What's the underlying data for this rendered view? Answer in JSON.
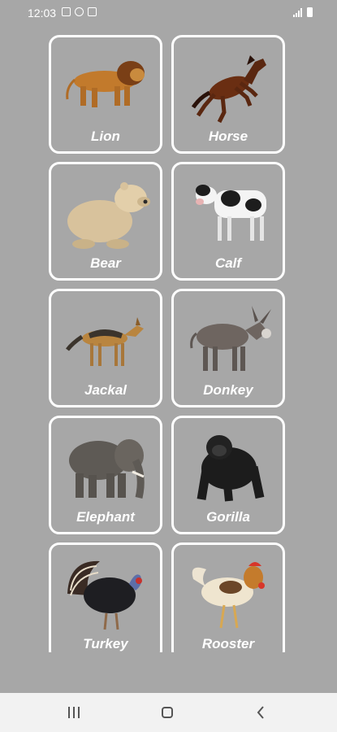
{
  "status_bar": {
    "time": "12:03"
  },
  "animals": [
    {
      "label": "Lion"
    },
    {
      "label": "Horse"
    },
    {
      "label": "Bear"
    },
    {
      "label": "Calf"
    },
    {
      "label": "Jackal"
    },
    {
      "label": "Donkey"
    },
    {
      "label": "Elephant"
    },
    {
      "label": "Gorilla"
    },
    {
      "label": "Turkey"
    },
    {
      "label": "Rooster"
    }
  ],
  "colors": {
    "background": "#a7a7a7",
    "card_border": "#ffffff",
    "nav_bar": "#f2f2f2"
  },
  "icons": {
    "status": [
      "gallery-icon",
      "android-icon",
      "app-icon",
      "signal-icon",
      "battery-icon"
    ],
    "nav": [
      "recents-icon",
      "home-icon",
      "back-icon"
    ]
  }
}
